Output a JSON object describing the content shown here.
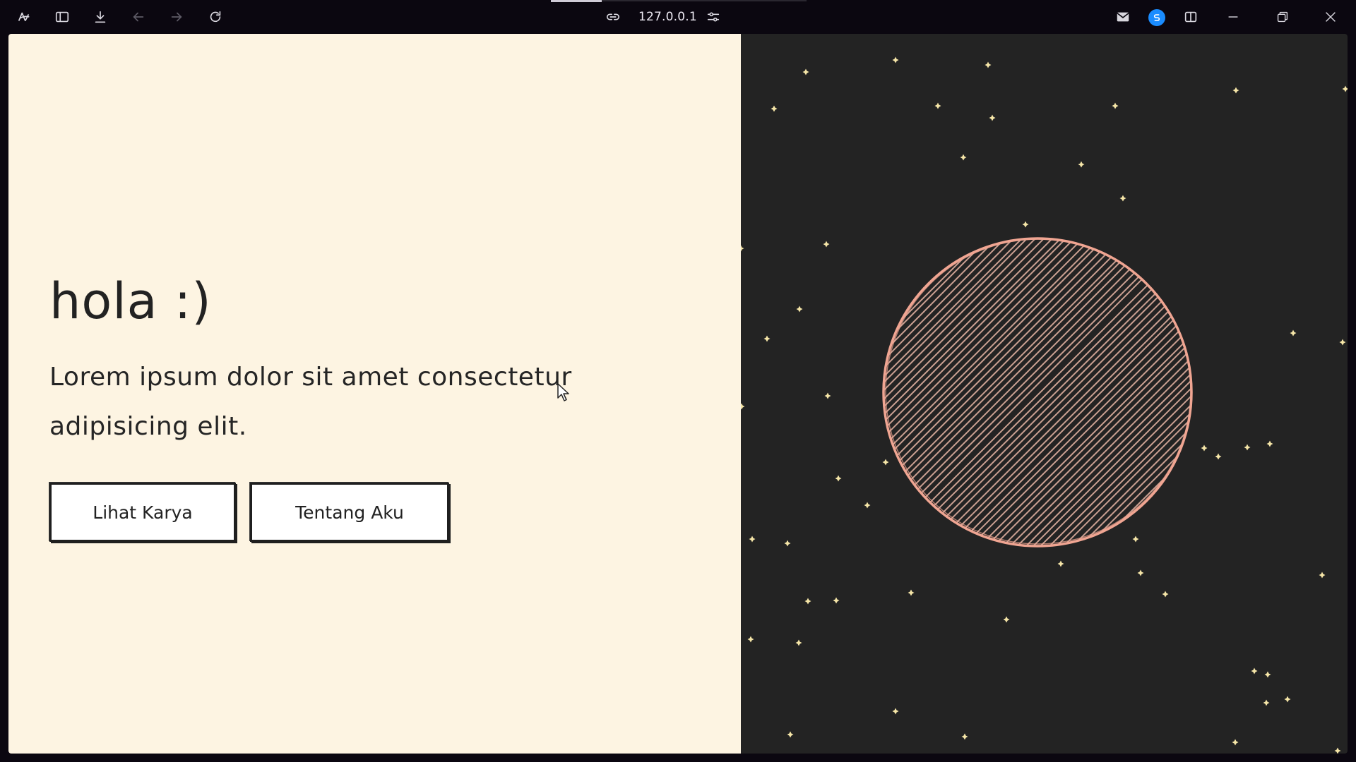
{
  "browser": {
    "url": "127.0.0.1",
    "icons": {
      "app_menu": "arc-logo-icon",
      "sidebar": "sidebar-toggle-icon",
      "download": "download-icon",
      "back": "back-arrow-icon",
      "forward": "forward-arrow-icon",
      "reload": "reload-icon",
      "link": "link-icon",
      "site_settings": "sliders-icon",
      "mail": "mail-icon",
      "extension": "extension-icon",
      "split_view": "split-view-icon",
      "minimize": "minimize-icon",
      "restore": "restore-icon",
      "close": "close-icon"
    }
  },
  "page": {
    "greeting": "hola :)",
    "tagline": "Lorem ipsum dolor sit amet consectetur adipisicing elit.",
    "buttons": {
      "primary": "Lihat Karya",
      "secondary": "Tentang Aku"
    },
    "colors": {
      "left_background": "#fdf4e2",
      "right_background": "#232323",
      "planet_stroke": "#f0a592",
      "star": "#f6e6a8"
    }
  }
}
